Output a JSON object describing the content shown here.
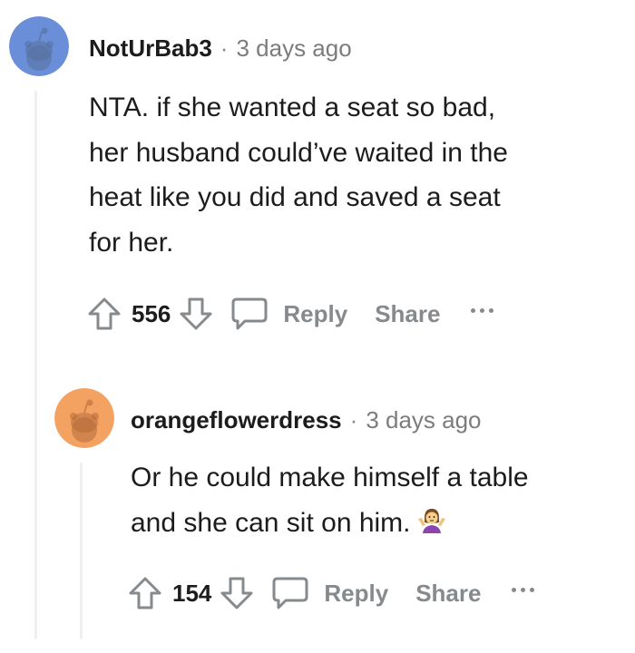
{
  "comments": [
    {
      "author": "NotUrBab3",
      "separator": "·",
      "time": "3 days ago",
      "body_lines": [
        "NTA. if she wanted a seat so bad,",
        "her husband could’ve waited in the",
        "heat like you did and saved a seat",
        "for her."
      ],
      "score": "556",
      "reply_label": "Reply",
      "share_label": "Share",
      "avatar_color": "#6a8fd8"
    },
    {
      "author": "orangeflowerdress",
      "separator": "·",
      "time": "3 days ago",
      "body_lines": [
        "Or he could make himself a table",
        "and she can sit on him."
      ],
      "emoji": "person-shrugging-emoji",
      "score": "154",
      "reply_label": "Reply",
      "share_label": "Share",
      "avatar_color": "#f4a261"
    }
  ],
  "colors": {
    "text_primary": "#1c1c1c",
    "text_muted": "#878a8c",
    "thread_line": "#edeff1"
  }
}
